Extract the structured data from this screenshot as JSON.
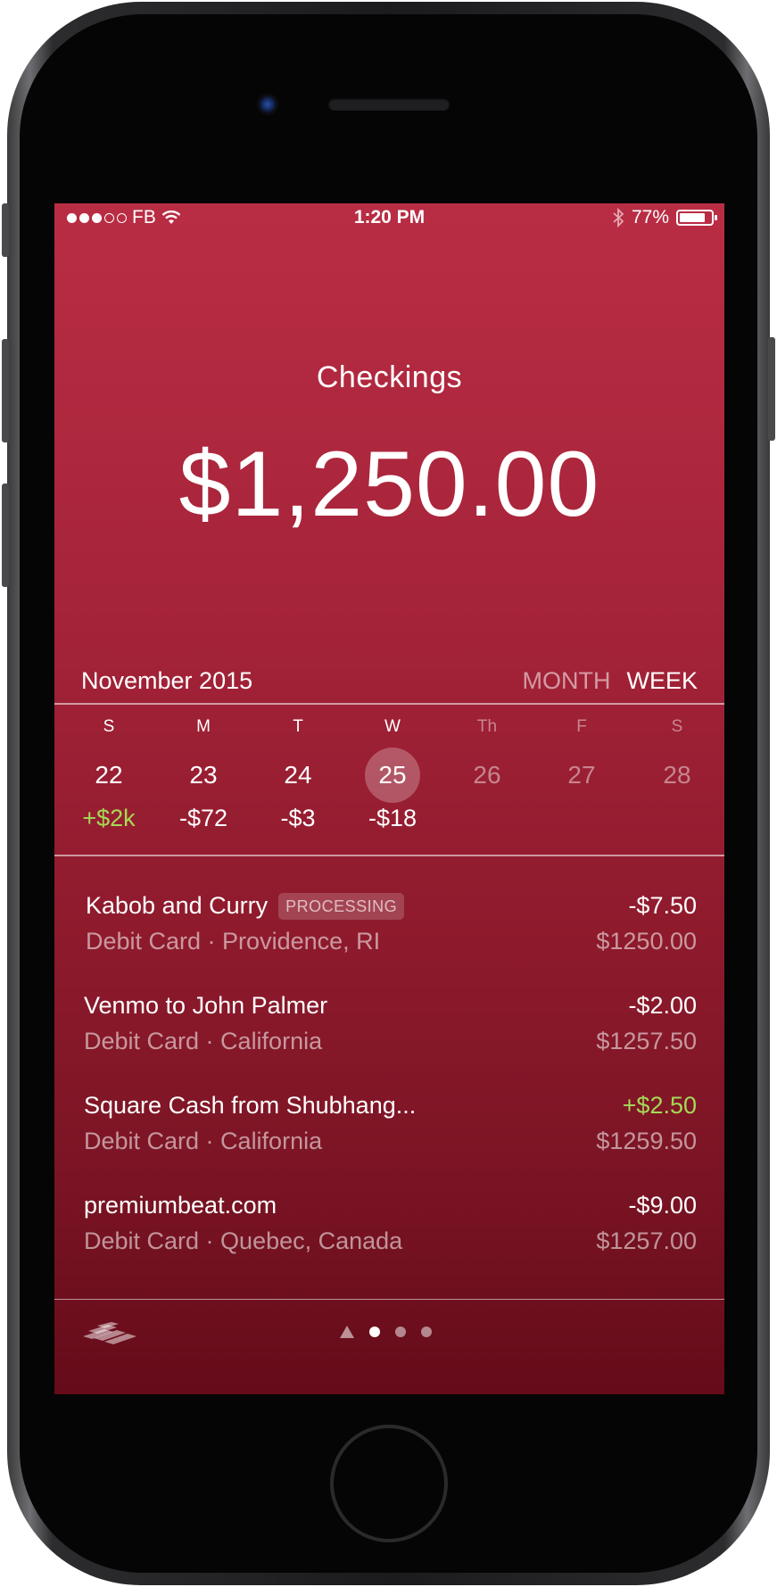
{
  "status_bar": {
    "carrier": "FB",
    "time": "1:20 PM",
    "battery": "77%",
    "signal_bars_filled": 3,
    "signal_bars_total": 5,
    "battery_level": 0.77
  },
  "account": {
    "name": "Checkings",
    "balance": "$1,250.00"
  },
  "calendar": {
    "month_label": "November 2015",
    "toggle_month": "MONTH",
    "toggle_week": "WEEK",
    "days": [
      {
        "letter": "S",
        "num": "22",
        "amount": "+$2k"
      },
      {
        "letter": "M",
        "num": "23",
        "amount": "-$72"
      },
      {
        "letter": "T",
        "num": "24",
        "amount": "-$3"
      },
      {
        "letter": "W",
        "num": "25",
        "amount": "-$18"
      },
      {
        "letter": "Th",
        "num": "26",
        "amount": ""
      },
      {
        "letter": "F",
        "num": "27",
        "amount": ""
      },
      {
        "letter": "S",
        "num": "28",
        "amount": ""
      }
    ]
  },
  "transactions": [
    {
      "name": "Kabob and Curry",
      "badge": "PROCESSING",
      "detail": "Debit Card · Providence, RI",
      "amount": "-$7.50",
      "balance": "$1250.00"
    },
    {
      "name": "Venmo to John Palmer",
      "badge": "",
      "detail": "Debit Card · California",
      "amount": "-$2.00",
      "balance": "$1257.50"
    },
    {
      "name": "Square Cash from Shubhang...",
      "badge": "",
      "detail": "Debit Card · California",
      "amount": "+$2.50",
      "balance": "$1259.50"
    },
    {
      "name": "premiumbeat.com",
      "badge": "",
      "detail": "Debit Card · Quebec, Canada",
      "amount": "-$9.00",
      "balance": "$1257.00"
    }
  ],
  "footer": {
    "bank_logo_icon": "bank-of-america-flag-icon",
    "page_count": 3,
    "active_page": 0
  },
  "colors": {
    "screen_top": "#b92d44",
    "screen_bottom": "#650b19",
    "positive": "#a6d957"
  }
}
